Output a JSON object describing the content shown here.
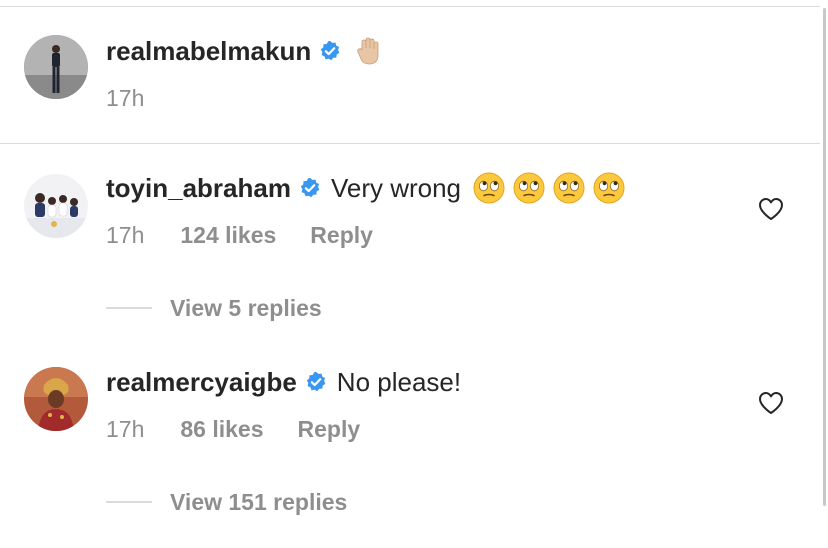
{
  "post": {
    "username": "realmabelmakun",
    "time": "17h",
    "emoji_icon": "raised-hand-emoji"
  },
  "comments": [
    {
      "username": "toyin_abraham",
      "text": "Very wrong",
      "time": "17h",
      "likes": "124 likes",
      "reply_label": "Reply",
      "view_replies": "View 5 replies",
      "emoji_icon": "face-with-rolling-eyes-emoji",
      "emoji_count": 4
    },
    {
      "username": "realmercyaigbe",
      "text": "No please!",
      "time": "17h",
      "likes": "86 likes",
      "reply_label": "Reply",
      "view_replies": "View 151 replies"
    }
  ],
  "colors": {
    "verified_badge": "#3897f0",
    "secondary_text": "#8e8e8e",
    "primary_text": "#262626",
    "divider": "#dbdbdb"
  }
}
